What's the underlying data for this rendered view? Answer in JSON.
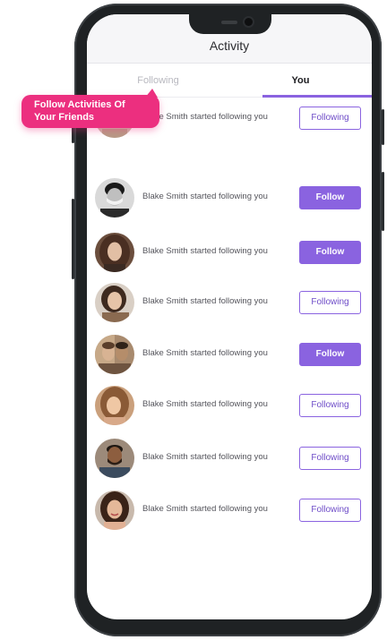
{
  "header": {
    "title": "Activity"
  },
  "tabs": [
    {
      "label": "Following",
      "active": false
    },
    {
      "label": "You",
      "active": true
    }
  ],
  "tooltip": {
    "line1": "Follow Activities Of",
    "line2": "Your Friends"
  },
  "colors": {
    "accent": "#8a63e0",
    "tooltip": "#ec2f7f"
  },
  "activity": [
    {
      "text": "Blake Smith started following you",
      "button": "Following",
      "button_style": "outline",
      "avatar": "avatar-1"
    },
    {
      "text": "Blake Smith started following you",
      "button": "Follow",
      "button_style": "solid",
      "avatar": "avatar-2"
    },
    {
      "text": "Blake Smith started following you",
      "button": "Follow",
      "button_style": "solid",
      "avatar": "avatar-3"
    },
    {
      "text": "Blake Smith started following you",
      "button": "Following",
      "button_style": "outline",
      "avatar": "avatar-4"
    },
    {
      "text": "Blake Smith started following you",
      "button": "Follow",
      "button_style": "solid",
      "avatar": "avatar-5"
    },
    {
      "text": "Blake Smith started following you",
      "button": "Following",
      "button_style": "outline",
      "avatar": "avatar-6"
    },
    {
      "text": "Blake Smith started following you",
      "button": "Following",
      "button_style": "outline",
      "avatar": "avatar-7"
    },
    {
      "text": "Blake Smith started following you",
      "button": "Following",
      "button_style": "outline",
      "avatar": "avatar-8"
    }
  ]
}
